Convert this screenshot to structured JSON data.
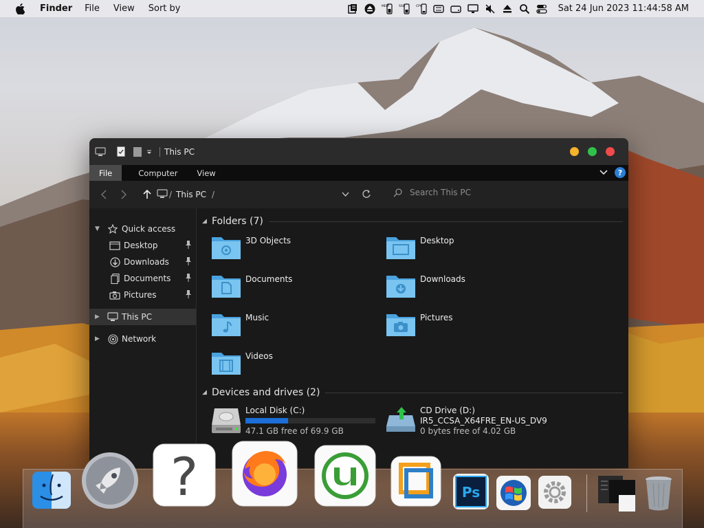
{
  "menubar": {
    "app_name": "Finder",
    "items": [
      "File",
      "View",
      "Sort by"
    ],
    "clock": "Sat 24 Jun 2023  11:44:58 AM",
    "tray_icons": [
      "notes-icon",
      "eject-circle-icon",
      "mem-meter-icon",
      "ssd-meter-icon",
      "cpu-meter-icon",
      "battery-list-icon",
      "drive-icon",
      "monitor-icon",
      "mute-icon",
      "eject-icon",
      "search-icon",
      "control-center-icon"
    ],
    "tray_labels": {
      "mem": "MEM",
      "ssd": "SSD",
      "cpu": "CPU"
    }
  },
  "window": {
    "title": "This PC",
    "ribbon_tabs": [
      "File",
      "Computer",
      "View"
    ],
    "help": "?",
    "breadcrumb": "This PC",
    "search_placeholder": "Search This PC",
    "traffic_colors": [
      "#f5b22a",
      "#2fc24a",
      "#f14a4a"
    ]
  },
  "sidebar": {
    "quick_access": "Quick access",
    "quick_items": [
      {
        "label": "Desktop",
        "icon": "desktop-icon"
      },
      {
        "label": "Downloads",
        "icon": "downloads-icon"
      },
      {
        "label": "Documents",
        "icon": "documents-icon"
      },
      {
        "label": "Pictures",
        "icon": "pictures-icon"
      }
    ],
    "this_pc": "This PC",
    "network": "Network"
  },
  "folders": {
    "header": "Folders (7)",
    "items": [
      "3D Objects",
      "Desktop",
      "Documents",
      "Downloads",
      "Music",
      "Pictures",
      "Videos"
    ]
  },
  "drives": {
    "header": "Devices and drives (2)",
    "items": [
      {
        "name": "Local Disk (C:)",
        "free": "47.1 GB free of 69.9 GB",
        "used_fraction": 0.33
      },
      {
        "name": "CD Drive (D:)",
        "label": "IR5_CCSA_X64FRE_EN-US_DV9",
        "free": "0 bytes free of 4.02 GB"
      }
    ]
  },
  "dock": {
    "apps": [
      "finder-icon",
      "launchpad-icon",
      "help-icon",
      "firefox-icon",
      "utorrent-icon",
      "vmware-icon",
      "photoshop-icon",
      "windows-icon",
      "settings-icon",
      "screenshot-stack-icon",
      "trash-icon"
    ],
    "photoshop_label": "Ps",
    "help_glyph": "?"
  }
}
